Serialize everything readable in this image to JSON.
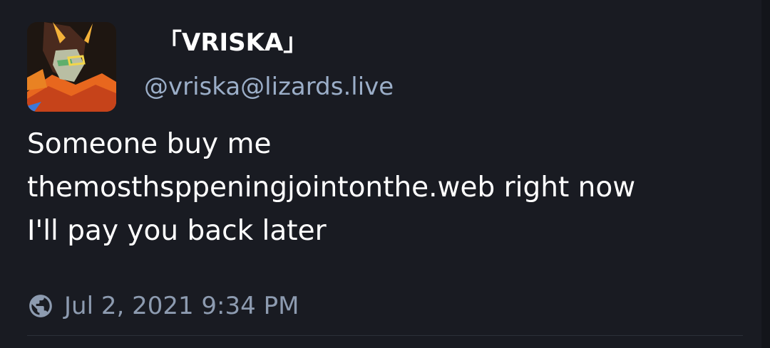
{
  "status": {
    "display_name": "「VRISKA」",
    "handle": "@vriska@lizards.live",
    "content": "Someone buy me\nthemosthsppeningjointonthe.web right now\nI'll pay you back later",
    "timestamp": "Jul 2, 2021 9:34 PM",
    "visibility_icon": "globe-icon",
    "avatar_icon": "avatar-image"
  },
  "colors": {
    "background": "#191b22",
    "text": "#ffffff",
    "secondary_text": "#9baec8"
  }
}
